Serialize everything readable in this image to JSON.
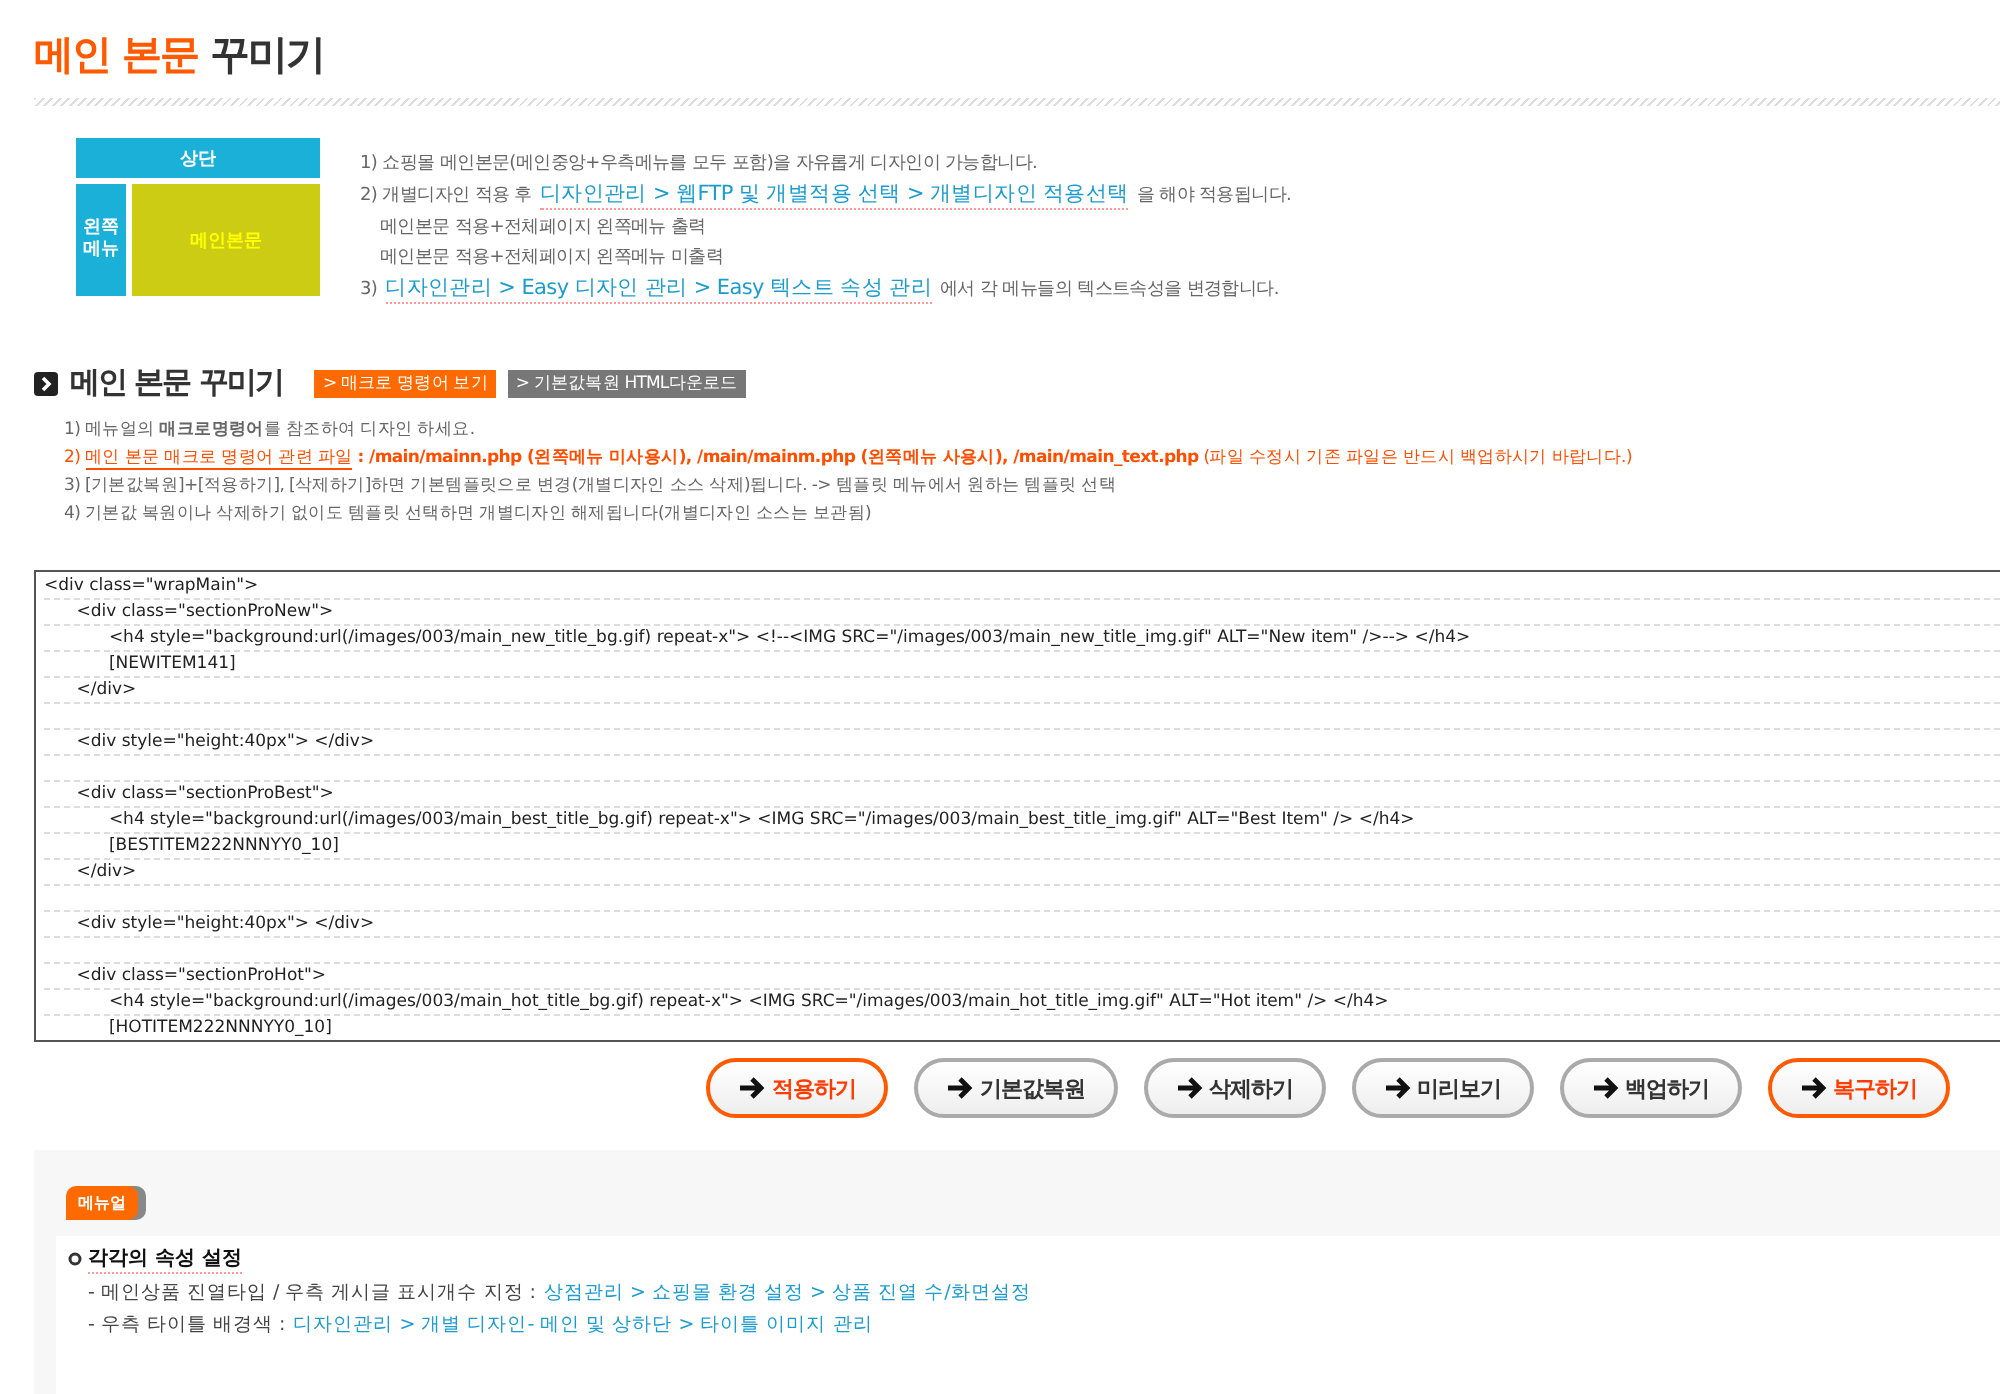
{
  "page_title": {
    "highlight": "메인 본문",
    "rest": "꾸미기"
  },
  "layout_diagram": {
    "top": "상단",
    "left": "왼쪽 메뉴",
    "main": "메인본문"
  },
  "intro_notes": [
    {
      "kind": "item",
      "parts": [
        {
          "kind": "plain",
          "text": "1) 쇼핑몰 메인본문(메인중앙+우측메뉴를 모두 포함)을 자유롭게 디자인이 가능합니다."
        }
      ]
    },
    {
      "kind": "item",
      "parts": [
        {
          "kind": "plain",
          "text": "2) 개별디자인 적용 후"
        },
        {
          "kind": "link",
          "text": "디자인관리 > 웹FTP 및 개별적용 선택 > 개별디자인 적용선택"
        },
        {
          "kind": "plain",
          "text": "을 해야 적용됩니다."
        }
      ]
    },
    {
      "kind": "sub",
      "parts": [
        {
          "kind": "plain",
          "text": "메인본문 적용+전체페이지 왼쪽메뉴 출력"
        }
      ]
    },
    {
      "kind": "sub",
      "parts": [
        {
          "kind": "plain",
          "text": "메인본문 적용+전체페이지 왼쪽메뉴 미출력"
        }
      ]
    },
    {
      "kind": "item",
      "parts": [
        {
          "kind": "plain",
          "text": "3)"
        },
        {
          "kind": "link",
          "text": "디자인관리 > Easy 디자인 관리 > Easy 텍스트 속성 관리"
        },
        {
          "kind": "plain",
          "text": "에서 각 메뉴들의 텍스트속성을 변경합니다."
        }
      ]
    }
  ],
  "section": {
    "title": "메인 본문 꾸미기",
    "tags": [
      {
        "kind": "orange",
        "label": "> 매크로 명령어 보기"
      },
      {
        "kind": "gray",
        "label": "> 기본값복원 HTML다운로드"
      }
    ]
  },
  "notes": [
    {
      "kind": "plain",
      "text": "1) 메뉴얼의 **매크로명령어**를 참조하여 디자인 하세요."
    },
    {
      "kind": "warning",
      "prefix": "2)",
      "link": "메인 본문 매크로 명령어 관련 파일",
      "text": "**: /main/mainn.php (왼쪽메뉴 미사용시), /main/mainm.php (왼쪽메뉴 사용시), /main/main_text.php** (파일 수정시 기존 파일은 반드시 백업하시기 바랍니다.)"
    },
    {
      "kind": "plain",
      "text": "3) [기본값복원]+[적용하기], [삭제하기]하면 기본템플릿으로 변경(개별디자인 소스 삭제)됩니다. -> 템플릿 메뉴에서 원하는 템플릿 선택"
    },
    {
      "kind": "plain",
      "text": "4) 기본값 복원이나 삭제하기 없이도 템플릿 선택하면 개별디자인 해제됩니다(개별디자인 소스는 보관됨)"
    }
  ],
  "code_lines": [
    {
      "kind": "code",
      "text": "<div class=\"wrapMain\">"
    },
    {
      "kind": "code",
      "text": "\t<div class=\"sectionProNew\">"
    },
    {
      "kind": "code",
      "text": "\t\t<h4 style=\"background:url(/images/003/main_new_title_bg.gif) repeat-x\"> <!--<IMG SRC=\"/images/003/main_new_title_img.gif\" ALT=\"New item\" />--> </h4>"
    },
    {
      "kind": "code",
      "text": "\t\t[NEWITEM141]"
    },
    {
      "kind": "code",
      "text": "\t</div>"
    },
    {
      "kind": "blank"
    },
    {
      "kind": "code",
      "text": "\t<div style=\"height:40px\"> </div>"
    },
    {
      "kind": "blank"
    },
    {
      "kind": "code",
      "text": "\t<div class=\"sectionProBest\">"
    },
    {
      "kind": "code",
      "text": "\t\t<h4 style=\"background:url(/images/003/main_best_title_bg.gif) repeat-x\"> <IMG SRC=\"/images/003/main_best_title_img.gif\" ALT=\"Best Item\" /> </h4>"
    },
    {
      "kind": "code",
      "text": "\t\t[BESTITEM222NNNYY0_10]"
    },
    {
      "kind": "code",
      "text": "\t</div>"
    },
    {
      "kind": "blank"
    },
    {
      "kind": "code",
      "text": "\t<div style=\"height:40px\"> </div>"
    },
    {
      "kind": "blank"
    },
    {
      "kind": "code",
      "text": "\t<div class=\"sectionProHot\">"
    },
    {
      "kind": "code",
      "text": "\t\t<h4 style=\"background:url(/images/003/main_hot_title_bg.gif) repeat-x\"> <IMG SRC=\"/images/003/main_hot_title_img.gif\" ALT=\"Hot item\" /> </h4>"
    },
    {
      "kind": "code",
      "text": "\t\t[HOTITEM222NNNYY0_10]"
    }
  ],
  "buttons": [
    {
      "kind": "primary",
      "label": "적용하기"
    },
    {
      "kind": "default",
      "label": "기본값복원"
    },
    {
      "kind": "default",
      "label": "삭제하기"
    },
    {
      "kind": "default",
      "label": "미리보기"
    },
    {
      "kind": "default",
      "label": "백업하기"
    },
    {
      "kind": "primary",
      "label": "복구하기"
    }
  ],
  "manual": {
    "badge": "메뉴얼",
    "heading": "각각의 속성 설정",
    "items": [
      {
        "label": "- 메인상품 진열타입 / 우측 게시글 표시개수 지정 :",
        "link": "상점관리 > 쇼핑몰 환경 설정 > 상품 진열 수/화면설정"
      },
      {
        "label": "- 우측 타이틀 배경색 :",
        "link": "디자인관리 > 개별 디자인- 메인 및 상하단 > 타이틀 이미지 관리"
      }
    ]
  }
}
